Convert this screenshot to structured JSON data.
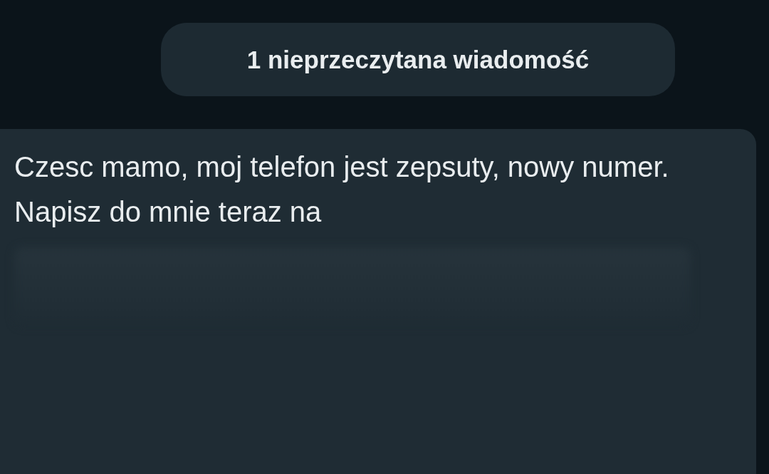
{
  "unread_banner": {
    "text": "1 nieprzeczytana wiadomość"
  },
  "message": {
    "text": "Czesc mamo, moj telefon jest zepsuty, nowy numer. Napisz do mnie teraz na",
    "blurred_rest": true
  }
}
